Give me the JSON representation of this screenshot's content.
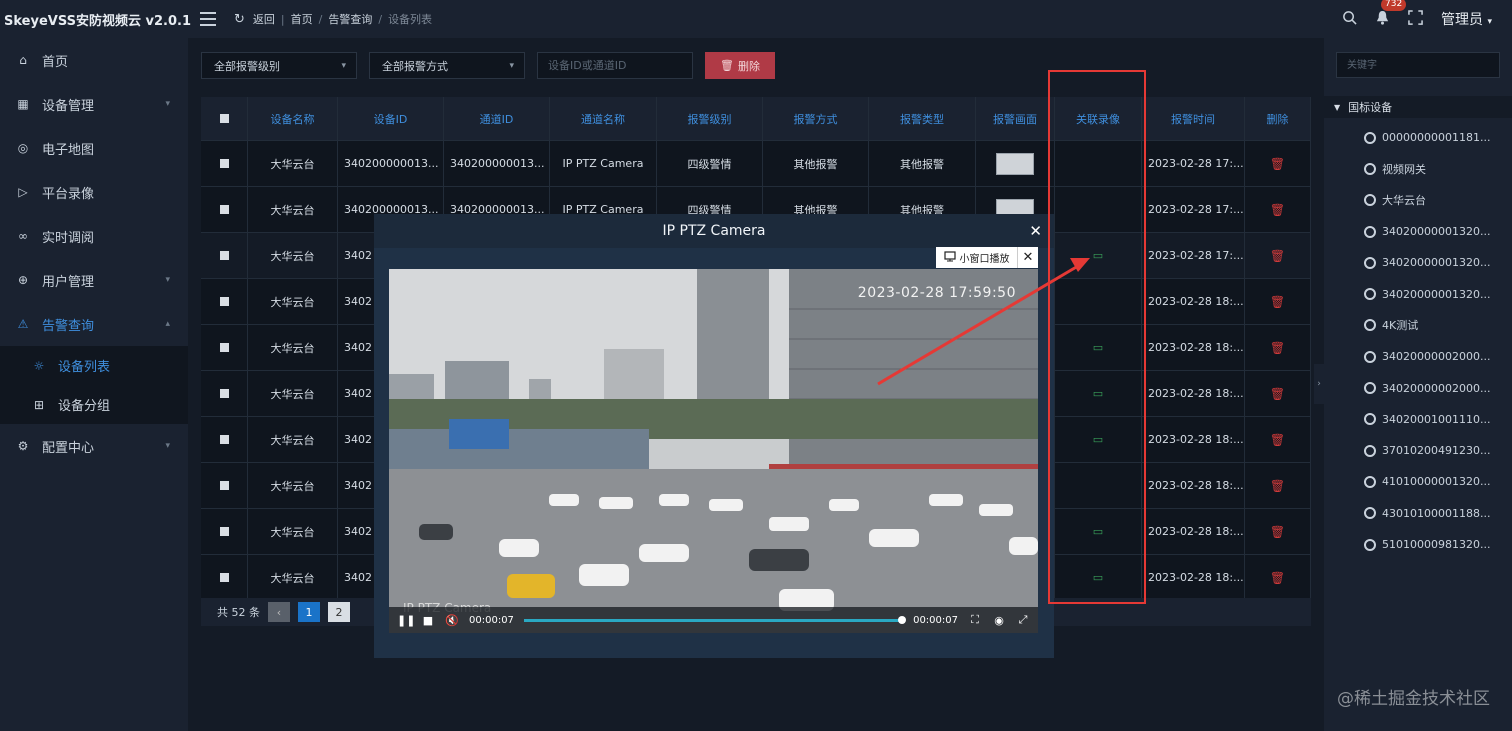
{
  "header": {
    "logo": "SkeyeVSS安防视频云 v2.0.1",
    "back": "返回",
    "breadcrumbs": [
      "首页",
      "告警查询",
      "设备列表"
    ],
    "badge_count": "732",
    "user": "管理员"
  },
  "sidebar": {
    "items": [
      {
        "label": "首页",
        "icon": "home-icon"
      },
      {
        "label": "设备管理",
        "icon": "device-icon"
      },
      {
        "label": "电子地图",
        "icon": "map-icon"
      },
      {
        "label": "平台录像",
        "icon": "record-icon"
      },
      {
        "label": "实时调阅",
        "icon": "live-icon"
      },
      {
        "label": "用户管理",
        "icon": "users-icon"
      },
      {
        "label": "告警查询",
        "icon": "alarm-icon"
      },
      {
        "label": "配置中心",
        "icon": "gear-icon"
      }
    ],
    "sub_items": [
      {
        "label": "设备列表",
        "icon": "bulb-icon"
      },
      {
        "label": "设备分组",
        "icon": "group-icon"
      }
    ]
  },
  "filters": {
    "level": "全部报警级别",
    "method": "全部报警方式",
    "search_placeholder": "设备ID或通道ID",
    "delete_label": "删除"
  },
  "table": {
    "headers": [
      "设备名称",
      "设备ID",
      "通道ID",
      "通道名称",
      "报警级别",
      "报警方式",
      "报警类型",
      "报警画面",
      "关联录像",
      "报警时间",
      "删除"
    ],
    "rows": [
      {
        "name": "大华云台",
        "device_id": "340200000013...",
        "channel_id": "340200000013...",
        "channel_name": "IP PTZ Camera",
        "level": "四级警情",
        "method": "其他报警",
        "type": "其他报警",
        "time": "2023-02-28 17:..."
      },
      {
        "name": "大华云台",
        "device_id": "340200000013...",
        "channel_id": "340200000013...",
        "channel_name": "IP PTZ Camera",
        "level": "四级警情",
        "method": "其他报警",
        "type": "其他报警",
        "time": "2023-02-28 17:..."
      },
      {
        "name": "大华云台",
        "device_id": "3402",
        "channel_id": "",
        "channel_name": "",
        "level": "",
        "method": "",
        "type": "",
        "time": "2023-02-28 17:..."
      },
      {
        "name": "大华云台",
        "device_id": "3402",
        "channel_id": "",
        "channel_name": "",
        "level": "",
        "method": "",
        "type": "",
        "time": "2023-02-28 18:..."
      },
      {
        "name": "大华云台",
        "device_id": "3402",
        "channel_id": "",
        "channel_name": "",
        "level": "",
        "method": "",
        "type": "",
        "time": "2023-02-28 18:..."
      },
      {
        "name": "大华云台",
        "device_id": "3402",
        "channel_id": "",
        "channel_name": "",
        "level": "",
        "method": "",
        "type": "",
        "time": "2023-02-28 18:..."
      },
      {
        "name": "大华云台",
        "device_id": "3402",
        "channel_id": "",
        "channel_name": "",
        "level": "",
        "method": "",
        "type": "",
        "time": "2023-02-28 18:..."
      },
      {
        "name": "大华云台",
        "device_id": "3402",
        "channel_id": "",
        "channel_name": "",
        "level": "",
        "method": "",
        "type": "",
        "time": "2023-02-28 18:..."
      },
      {
        "name": "大华云台",
        "device_id": "3402",
        "channel_id": "",
        "channel_name": "",
        "level": "",
        "method": "",
        "type": "",
        "time": "2023-02-28 18:..."
      },
      {
        "name": "大华云台",
        "device_id": "3402",
        "channel_id": "",
        "channel_name": "",
        "level": "",
        "method": "",
        "type": "",
        "time": "2023-02-28 18:..."
      }
    ]
  },
  "pager": {
    "total": "共 52 条",
    "pages": [
      "1",
      "2"
    ]
  },
  "right_panel": {
    "search_placeholder": "关键字",
    "root": "国标设备",
    "items": [
      "00000000001181...",
      "视频网关",
      "大华云台",
      "34020000001320...",
      "34020000001320...",
      "34020000001320...",
      "4K测试",
      "34020000002000...",
      "34020000002000...",
      "34020001001110...",
      "37010200491230...",
      "41010000001320...",
      "43010100001188...",
      "51010000981320..."
    ]
  },
  "modal": {
    "title": "IP PTZ Camera",
    "mini_play": "小窗口播放",
    "timestamp": "2023-02-28 17:59:50",
    "camera_label": "IP PTZ Camera",
    "time_current": "00:00:07",
    "time_total": "00:00:07"
  },
  "watermark": "@稀土掘金技术社区"
}
